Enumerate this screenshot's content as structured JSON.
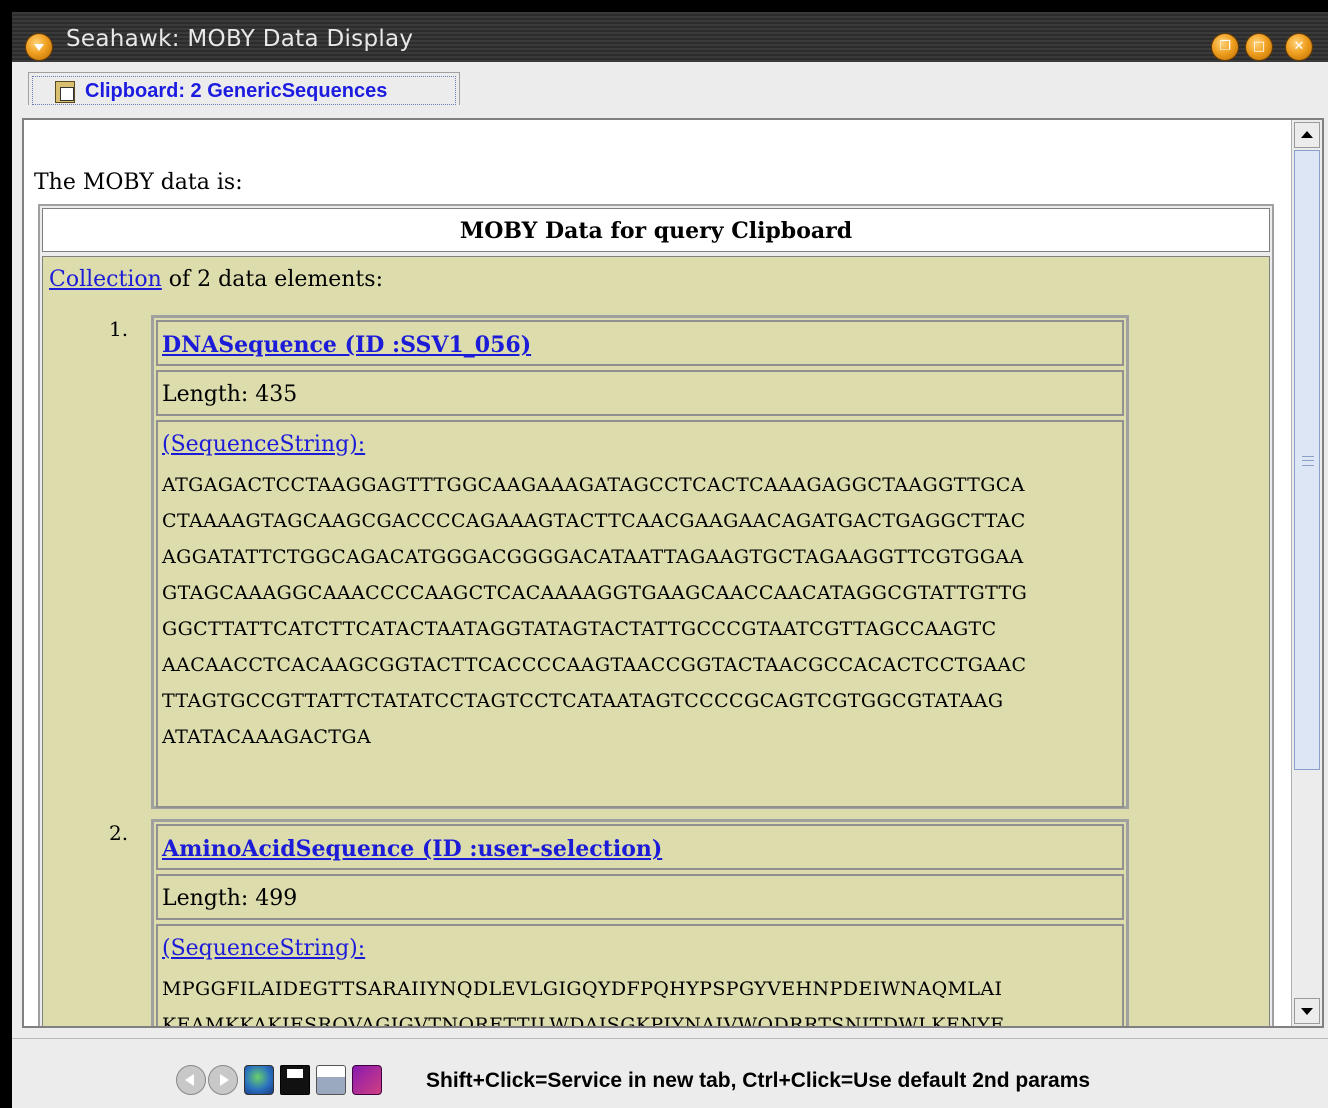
{
  "window": {
    "title": "Seahawk: MOBY Data Display",
    "controls": [
      "restore-icon",
      "minimize-icon",
      "close-icon"
    ]
  },
  "tab": {
    "label": "Clipboard: 2 GenericSequences",
    "icon": "clipboard-icon"
  },
  "document": {
    "intro": "The MOBY data is:",
    "table_header": "MOBY Data for query Clipboard",
    "collection_link": "Collection",
    "collection_suffix": " of 2 data elements:",
    "items": [
      {
        "number": "1.",
        "title": "DNASequence (ID :SSV1_056)",
        "length": "Length: 435",
        "seq_label": "(SequenceString):",
        "lines": [
          "ATGAGACTCCTAAGGAGTTTGGCAAGAAAGATAGCCTCACTCAAAGAGGCTAAGGTTGCA",
          "CTAAAAGTAGCAAGCGACCCCAGAAAGTACTTCAACGAAGAACAGATGACTGAGGCTTAC",
          "AGGATATTCTGGCAGACATGGGACGGGGACATAATTAGAAGTGCTAGAAGGTTCGTGGAA",
          "GTAGCAAAGGCAAACCCCAAGCTCACAAAAGGTGAAGCAACCAACATAGGCGTATTGTTG",
          "GGCTTATTCATCTTCATACTAATAGGTATAGTACTATTGCCCGTAATCGTTAGCCAAGTC",
          "AACAACCTCACAAGCGGTACTTCACCCCAAGTAACCGGTACTAACGCCACACTCCTGAAC",
          "TTAGTGCCGTTATTCTATATCCTAGTCCTCATAATAGTCCCCGCAGTCGTGGCGTATAAG",
          "ATATACAAAGACTGA"
        ]
      },
      {
        "number": "2.",
        "title": "AminoAcidSequence (ID :user-selection)",
        "length": "Length: 499",
        "seq_label": "(SequenceString):",
        "lines": [
          "MPGGFILAIDEGTTSARAIIYNQDLEVLGIGQYDFPQHYPSPGYVEHNPDEIWNAQMLAI",
          "KEAMKKAKIESRQVAGIGVTNQRETTILWDAISGKPIYNAIVWQDRRTSNITDWLKENYF"
        ]
      }
    ]
  },
  "statusbar": {
    "icons": [
      "back-icon",
      "forward-icon",
      "globe-icon",
      "save-icon",
      "print-icon",
      "book-icon"
    ],
    "text": "Shift+Click=Service in new tab, Ctrl+Click=Use default 2nd params"
  }
}
